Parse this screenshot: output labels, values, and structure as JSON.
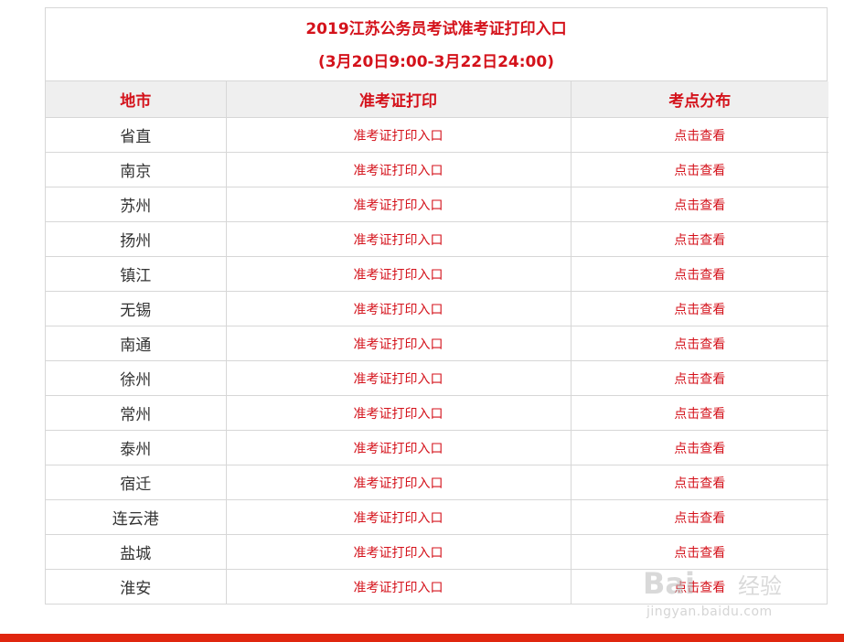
{
  "title": {
    "line1": "2019江苏公务员考试准考证打印入口",
    "line2": "(3月20日9:00-3月22日24:00)"
  },
  "headers": [
    "地市",
    "准考证打印",
    "考点分布"
  ],
  "rows": [
    {
      "city": "省直",
      "print_link": "准考证打印入口",
      "view_link": "点击查看"
    },
    {
      "city": "南京",
      "print_link": "准考证打印入口",
      "view_link": "点击查看"
    },
    {
      "city": "苏州",
      "print_link": "准考证打印入口",
      "view_link": "点击查看"
    },
    {
      "city": "扬州",
      "print_link": "准考证打印入口",
      "view_link": "点击查看"
    },
    {
      "city": "镇江",
      "print_link": "准考证打印入口",
      "view_link": "点击查看"
    },
    {
      "city": "无锡",
      "print_link": "准考证打印入口",
      "view_link": "点击查看"
    },
    {
      "city": "南通",
      "print_link": "准考证打印入口",
      "view_link": "点击查看"
    },
    {
      "city": "徐州",
      "print_link": "准考证打印入口",
      "view_link": "点击查看"
    },
    {
      "city": "常州",
      "print_link": "准考证打印入口",
      "view_link": "点击查看"
    },
    {
      "city": "泰州",
      "print_link": "准考证打印入口",
      "view_link": "点击查看"
    },
    {
      "city": "宿迁",
      "print_link": "准考证打印入口",
      "view_link": "点击查看"
    },
    {
      "city": "连云港",
      "print_link": "准考证打印入口",
      "view_link": "点击查看"
    },
    {
      "city": "盐城",
      "print_link": "准考证打印入口",
      "view_link": "点击查看"
    },
    {
      "city": "淮安",
      "print_link": "准考证打印入口",
      "view_link": "点击查看"
    }
  ],
  "watermark": {
    "logo": "Bai",
    "text": "经验",
    "url": "jingyan.baidu.com"
  },
  "colors": {
    "accent_red": "#d4121b",
    "bottom_bar": "#e0260f",
    "header_bg": "#efefef",
    "border": "#d7d7d7"
  }
}
